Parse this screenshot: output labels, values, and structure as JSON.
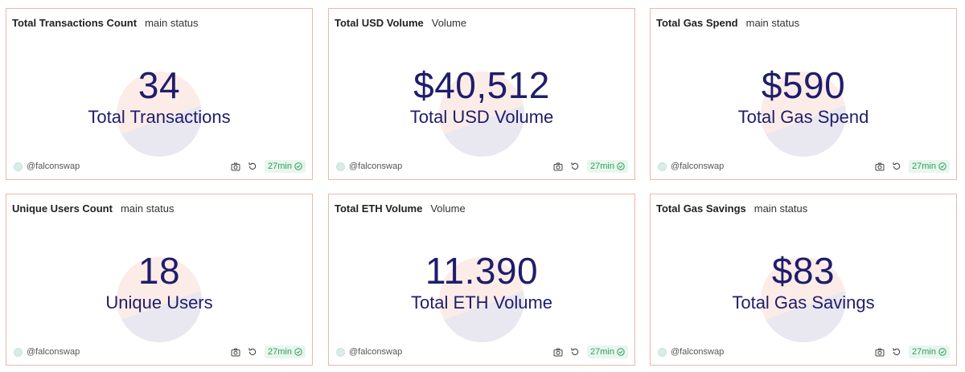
{
  "cards": [
    {
      "title": "Total Transactions Count",
      "subtitle": "main status",
      "value": "34",
      "label": "Total Transactions",
      "author": "@falconswap",
      "freshness": "27min"
    },
    {
      "title": "Total USD Volume",
      "subtitle": "Volume",
      "value": "$40,512",
      "label": "Total USD Volume",
      "author": "@falconswap",
      "freshness": "27min"
    },
    {
      "title": "Total Gas Spend",
      "subtitle": "main status",
      "value": "$590",
      "label": "Total Gas Spend",
      "author": "@falconswap",
      "freshness": "27min"
    },
    {
      "title": "Unique Users Count",
      "subtitle": "main status",
      "value": "18",
      "label": "Unique Users",
      "author": "@falconswap",
      "freshness": "27min"
    },
    {
      "title": "Total ETH Volume",
      "subtitle": "Volume",
      "value": "11.390",
      "label": "Total ETH Volume",
      "author": "@falconswap",
      "freshness": "27min"
    },
    {
      "title": "Total Gas Savings",
      "subtitle": "main status",
      "value": "$83",
      "label": "Total Gas Savings",
      "author": "@falconswap",
      "freshness": "27min"
    }
  ],
  "icons": {
    "screenshot": "camera-icon",
    "refresh": "refresh-icon",
    "status": "check-circle-icon"
  },
  "colors": {
    "card_border": "#e9b9a8",
    "metric_text": "#1f1d6b",
    "fresh_badge_bg": "#e8f6ee",
    "fresh_badge_text": "#2e9d5a"
  }
}
